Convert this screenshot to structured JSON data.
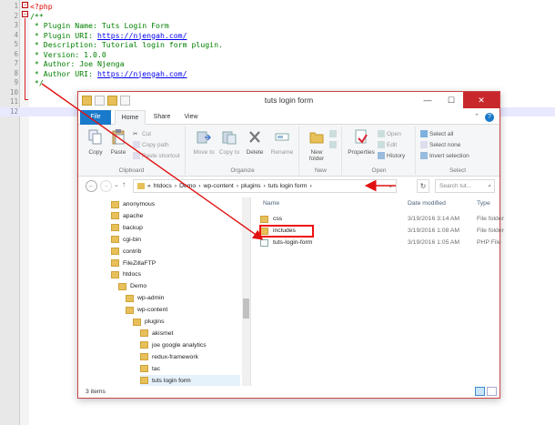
{
  "editor": {
    "lines": [
      {
        "num": "1",
        "parts": [
          {
            "t": "<?php",
            "c": "tag"
          }
        ]
      },
      {
        "num": "2",
        "parts": [
          {
            "t": "/**",
            "c": "cmt"
          }
        ]
      },
      {
        "num": "3",
        "parts": [
          {
            "t": " * Plugin Name: Tuts Login Form",
            "c": "cmt"
          }
        ]
      },
      {
        "num": "4",
        "parts": [
          {
            "t": " * Plugin URI: ",
            "c": "cmt"
          },
          {
            "t": "https://njengah.com/",
            "c": "url"
          }
        ]
      },
      {
        "num": "5",
        "parts": [
          {
            "t": " * Description: Tutorial login form plugin.",
            "c": "cmt"
          }
        ]
      },
      {
        "num": "6",
        "parts": [
          {
            "t": " * Version: 1.0.0",
            "c": "cmt"
          }
        ]
      },
      {
        "num": "7",
        "parts": [
          {
            "t": " * Author: Joe Njenga",
            "c": "cmt"
          }
        ]
      },
      {
        "num": "8",
        "parts": [
          {
            "t": " * Author URI: ",
            "c": "cmt"
          },
          {
            "t": "https://njengah.com/",
            "c": "url"
          }
        ]
      },
      {
        "num": "9",
        "parts": [
          {
            "t": " */",
            "c": "cmt"
          }
        ]
      },
      {
        "num": "10",
        "parts": []
      },
      {
        "num": "11",
        "parts": []
      },
      {
        "num": "12",
        "parts": []
      }
    ]
  },
  "window": {
    "title": "tuts login form",
    "minimize": "—",
    "maximize": "☐",
    "close": "✕",
    "help": "?",
    "collapse": "⌃"
  },
  "ribbon_tabs": {
    "file": "File",
    "home": "Home",
    "share": "Share",
    "view": "View"
  },
  "ribbon": {
    "clipboard": {
      "label": "Clipboard",
      "copy": "Copy",
      "paste": "Paste",
      "cut": "Cut",
      "copy_path": "Copy path",
      "paste_shortcut": "Paste shortcut"
    },
    "organize": {
      "label": "Organize",
      "move_to": "Move to",
      "copy_to": "Copy to",
      "delete": "Delete",
      "rename": "Rename"
    },
    "new": {
      "label": "New",
      "new_folder": "New folder"
    },
    "open": {
      "label": "Open",
      "properties": "Properties",
      "open": "Open",
      "edit": "Edit",
      "history": "History"
    },
    "select": {
      "label": "Select",
      "select_all": "Select all",
      "select_none": "Select none",
      "invert": "Invert selection"
    }
  },
  "address": {
    "back": "←",
    "forward": "→",
    "recent": "⌄",
    "up": "↑",
    "overflow": "«",
    "path": [
      "htdocs",
      "Demo",
      "wp-content",
      "plugins",
      "tuts login form"
    ],
    "separator": "›",
    "dropdown": "⌄",
    "refresh": "↻",
    "search_placeholder": "Search tut...",
    "search_glyph": "⌕"
  },
  "nav_tree": [
    {
      "label": "anonymous",
      "indent": 0
    },
    {
      "label": "apache",
      "indent": 0
    },
    {
      "label": "backup",
      "indent": 0
    },
    {
      "label": "cgi-bin",
      "indent": 0
    },
    {
      "label": "contrib",
      "indent": 0
    },
    {
      "label": "FileZillaFTP",
      "indent": 0
    },
    {
      "label": "htdocs",
      "indent": 0
    },
    {
      "label": "Demo",
      "indent": 1
    },
    {
      "label": "wp-admin",
      "indent": 2
    },
    {
      "label": "wp-content",
      "indent": 2
    },
    {
      "label": "plugins",
      "indent": 3
    },
    {
      "label": "akismet",
      "indent": 4
    },
    {
      "label": "joe google analytics",
      "indent": 4
    },
    {
      "label": "redux-framework",
      "indent": 4
    },
    {
      "label": "tac",
      "indent": 4
    },
    {
      "label": "tuts login form",
      "indent": 4,
      "selected": true
    }
  ],
  "columns": {
    "name": "Name",
    "date": "Date modified",
    "type": "Type"
  },
  "files": [
    {
      "name": "css",
      "date": "3/19/2016 3:14 AM",
      "type": "File folder",
      "kind": "folder"
    },
    {
      "name": "includes",
      "date": "3/19/2016 1:08 AM",
      "type": "File folder",
      "kind": "folder"
    },
    {
      "name": "tuts-login-form",
      "date": "3/19/2016 1:05 AM",
      "type": "PHP File",
      "kind": "php"
    }
  ],
  "status": {
    "items": "3 items"
  },
  "colors": {
    "annotation": "#e11111",
    "file_tab": "#1979ca",
    "close_button": "#c8282c"
  }
}
